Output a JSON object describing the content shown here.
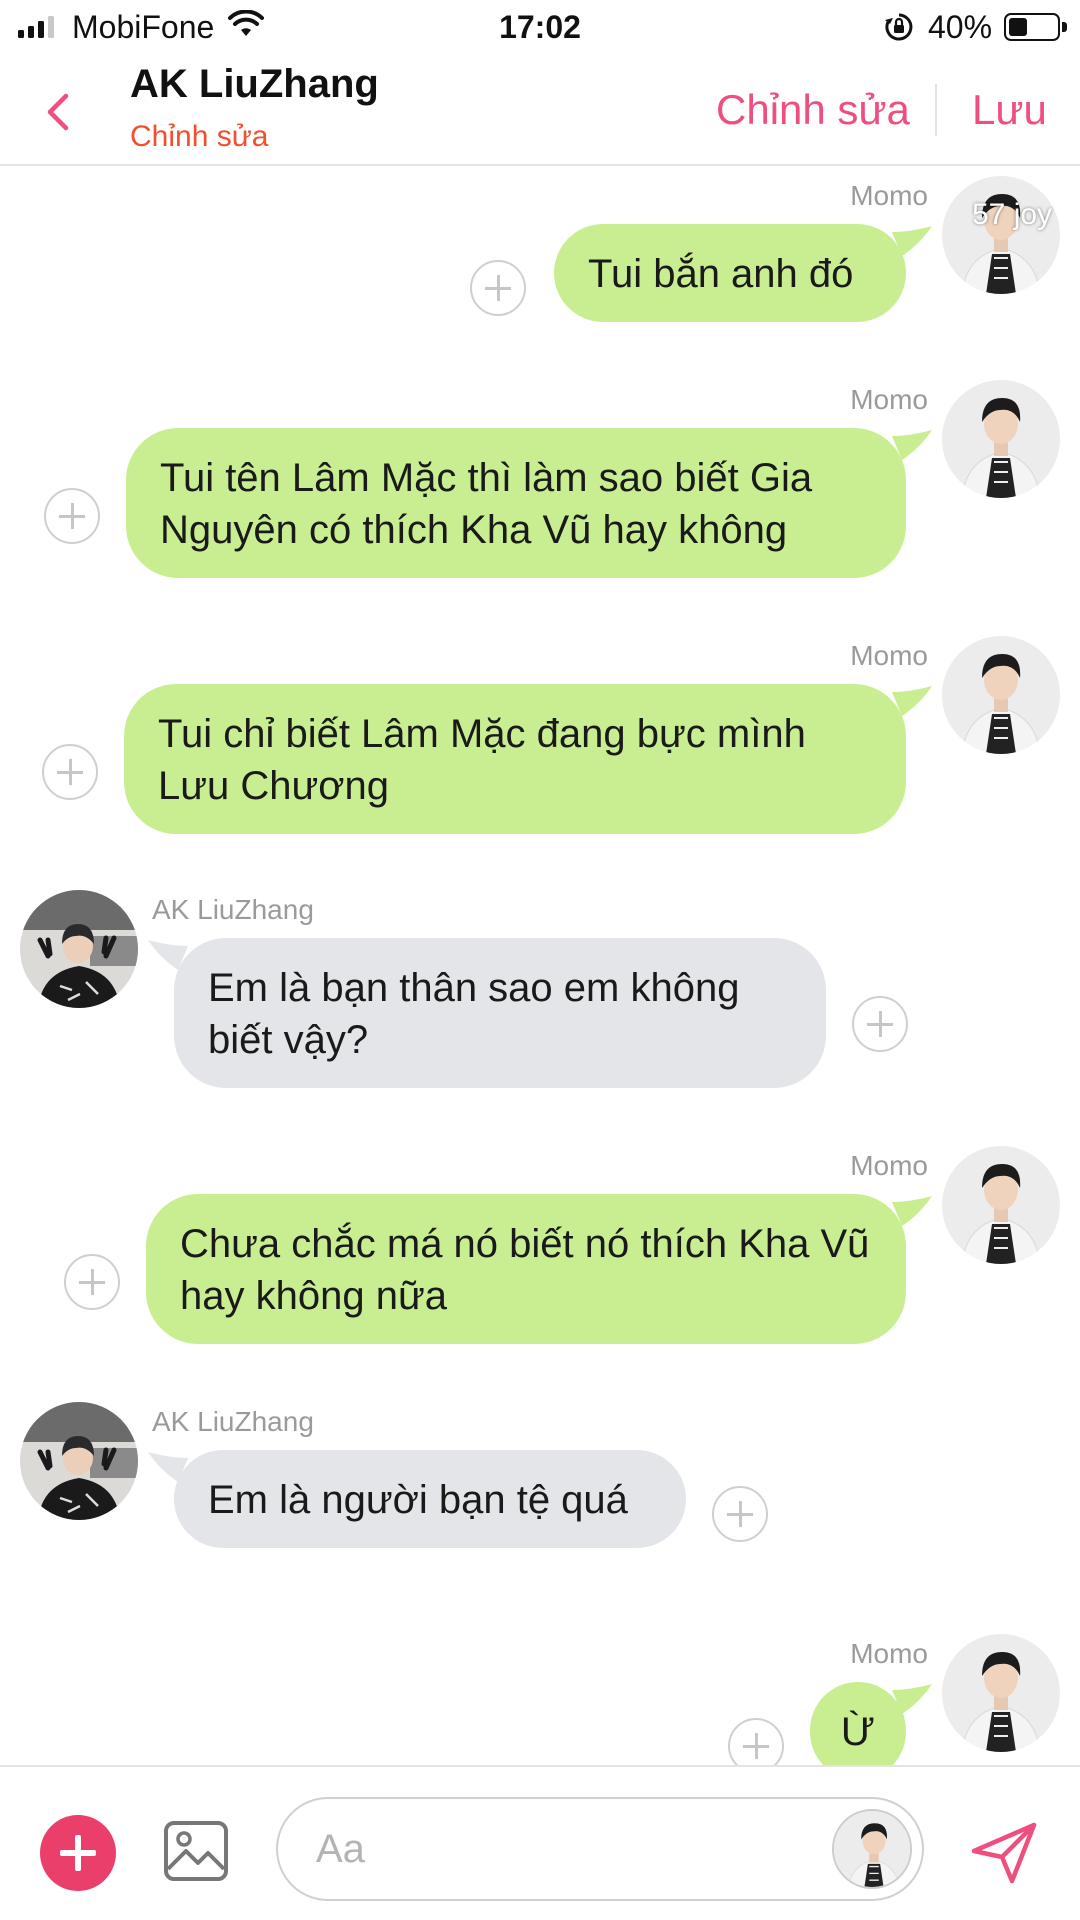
{
  "status_bar": {
    "carrier": "MobiFone",
    "time": "17:02",
    "battery_percent": "40%",
    "battery_level": 0.4,
    "signal_bars": 3
  },
  "header": {
    "back_icon": "chevron-left-icon",
    "title": "AK LiuZhang",
    "subtitle": "Chỉnh sửa",
    "edit_label": "Chỉnh sửa",
    "save_label": "Lưu"
  },
  "colors": {
    "accent": "#ee4f7f",
    "subtitle": "#f0502e",
    "outgoing_bubble": "#c9ee91",
    "incoming_bubble": "#e4e5e9"
  },
  "messages": [
    {
      "sender": "Momo",
      "side": "me",
      "text": "Tui bắn anh đó"
    },
    {
      "sender": "Momo",
      "side": "me",
      "text": "Tui tên Lâm Mặc thì làm sao biết Gia Nguyên có thích Kha Vũ hay không"
    },
    {
      "sender": "Momo",
      "side": "me",
      "text": "Tui chỉ biết Lâm Mặc đang bực mình Lưu Chương"
    },
    {
      "sender": "AK LiuZhang",
      "side": "them",
      "text": "Em là bạn thân sao em không biết vậy?"
    },
    {
      "sender": "Momo",
      "side": "me",
      "text": "Chưa chắc má nó biết nó thích Kha Vũ hay không nữa"
    },
    {
      "sender": "AK LiuZhang",
      "side": "them",
      "text": "Em là người bạn tệ quá"
    },
    {
      "sender": "Momo",
      "side": "me",
      "text": "Ừ"
    }
  ],
  "watermark": "57 joy",
  "composer": {
    "placeholder": "Aa",
    "value": ""
  }
}
